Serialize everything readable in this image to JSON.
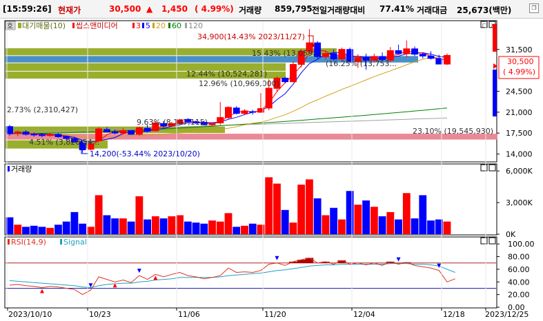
{
  "header": {
    "time": "[15:59:26]",
    "price_label": "현재가",
    "price": "30,500",
    "arrow": "▲",
    "change": "1,450",
    "change_pct": "( 4.99%)",
    "volume_label": "거래량",
    "volume": "859,795",
    "prev_vol_label": "전일거래량대비",
    "prev_vol_ratio": "77.41%",
    "amount_label": "거래대금",
    "amount": "25,673(백만)",
    "restore_icon": "restore-icon"
  },
  "colors": {
    "up": "#ff0000",
    "down": "#0000ff",
    "ma3": "#ff0000",
    "ma5": "#0000ff",
    "ma20": "#d4a017",
    "ma60": "#008000",
    "ma120": "#a0a0a0",
    "band_green": "#9aae2e",
    "band_blue": "#4a90c8",
    "band_pink": "#e98a96",
    "rsi": "#e03020",
    "signal": "#20a0c0",
    "rsi_fill": "#b00000"
  },
  "main_panel": {
    "legend": {
      "market_profile": "대기매물(10)",
      "stock_name": "씹스앤미디어",
      "ma3": "3",
      "ma5": "5",
      "ma20": "20",
      "ma60": "60",
      "ma120": "120"
    },
    "y_ticks": [
      "31,500",
      "24,500",
      "21,000",
      "17,500",
      "14,000"
    ],
    "current_price_box": "30,500",
    "current_pct_box": "( 4.99%)",
    "high_annotation": "34,900(14.43% 2023/11/27)",
    "low_annotation": "14,200(-53.44% 2023/10/20)",
    "volume_bands": [
      {
        "label": "15.43% (13,059...",
        "color": "green"
      },
      {
        "label": "(16.25% (13,753...",
        "color": "blue"
      },
      {
        "label": "12.44% (10,524,281)",
        "color": "green"
      },
      {
        "label": "12.96% (10,969,000)",
        "color": "green"
      },
      {
        "label": "2.73% (2,310,427)",
        "color": "none"
      },
      {
        "label": "9.63% (8,147,115)",
        "color": "green"
      },
      {
        "label": "23.10% (19,545,930)",
        "color": "pink"
      },
      {
        "label": "4.51% (3,820,54...",
        "color": "green"
      }
    ],
    "badge": "호"
  },
  "volume_panel": {
    "legend": "거래량",
    "y_ticks": [
      "6,000K",
      "3,000K",
      "0K"
    ]
  },
  "rsi_panel": {
    "legend_rsi": "RSI(14,9)",
    "legend_signal": "Signal",
    "y_ticks": [
      "100.00",
      "80.00",
      "60.00",
      "40.00",
      "20.00",
      "0.00"
    ]
  },
  "x_axis": {
    "labels": [
      "2023/10/10",
      "10/23",
      "11/06",
      "11/20",
      "12/04",
      "12/18",
      "2023/12/25"
    ]
  },
  "chart_data": {
    "type": "candlestick",
    "candles": [
      {
        "o": 18600,
        "h": 18900,
        "l": 17100,
        "c": 17400
      },
      {
        "o": 17600,
        "h": 18000,
        "l": 17000,
        "c": 17700
      },
      {
        "o": 17700,
        "h": 18000,
        "l": 17100,
        "c": 17300
      },
      {
        "o": 17300,
        "h": 17600,
        "l": 16900,
        "c": 17200
      },
      {
        "o": 17200,
        "h": 17500,
        "l": 16800,
        "c": 17100
      },
      {
        "o": 17100,
        "h": 17500,
        "l": 16900,
        "c": 17300
      },
      {
        "o": 17300,
        "h": 17500,
        "l": 16700,
        "c": 16900
      },
      {
        "o": 16900,
        "h": 17100,
        "l": 16300,
        "c": 16600
      },
      {
        "o": 16600,
        "h": 16900,
        "l": 15900,
        "c": 16000
      },
      {
        "o": 15800,
        "h": 16000,
        "l": 14200,
        "c": 14700
      },
      {
        "o": 14800,
        "h": 16200,
        "l": 14600,
        "c": 15700
      },
      {
        "o": 16200,
        "h": 18500,
        "l": 16000,
        "c": 18200
      },
      {
        "o": 18100,
        "h": 18500,
        "l": 17600,
        "c": 17700
      },
      {
        "o": 17700,
        "h": 18100,
        "l": 17300,
        "c": 17500
      },
      {
        "o": 17500,
        "h": 18300,
        "l": 17300,
        "c": 17900
      },
      {
        "o": 17900,
        "h": 18000,
        "l": 17200,
        "c": 17300
      },
      {
        "o": 17300,
        "h": 18600,
        "l": 17100,
        "c": 18400
      },
      {
        "o": 18300,
        "h": 18900,
        "l": 17600,
        "c": 17800
      },
      {
        "o": 17900,
        "h": 19500,
        "l": 17800,
        "c": 19200
      },
      {
        "o": 19100,
        "h": 19500,
        "l": 18400,
        "c": 18700
      },
      {
        "o": 18700,
        "h": 19400,
        "l": 18500,
        "c": 19100
      },
      {
        "o": 19100,
        "h": 19900,
        "l": 18800,
        "c": 19700
      },
      {
        "o": 19800,
        "h": 20000,
        "l": 19300,
        "c": 19400
      },
      {
        "o": 19400,
        "h": 19600,
        "l": 19000,
        "c": 19200
      },
      {
        "o": 19300,
        "h": 19600,
        "l": 18800,
        "c": 18900
      },
      {
        "o": 18900,
        "h": 19300,
        "l": 18700,
        "c": 19100
      },
      {
        "o": 19200,
        "h": 22700,
        "l": 18900,
        "c": 20100
      },
      {
        "o": 20100,
        "h": 22000,
        "l": 19900,
        "c": 21800
      },
      {
        "o": 21700,
        "h": 22000,
        "l": 20600,
        "c": 20800
      },
      {
        "o": 20800,
        "h": 21500,
        "l": 20500,
        "c": 21200
      },
      {
        "o": 21100,
        "h": 21400,
        "l": 20600,
        "c": 21000
      },
      {
        "o": 21000,
        "h": 24200,
        "l": 20900,
        "c": 21600
      },
      {
        "o": 21700,
        "h": 26500,
        "l": 21300,
        "c": 25000
      },
      {
        "o": 25000,
        "h": 27000,
        "l": 24500,
        "c": 26700
      },
      {
        "o": 26700,
        "h": 26900,
        "l": 25800,
        "c": 26100
      },
      {
        "o": 26100,
        "h": 29500,
        "l": 26000,
        "c": 29000
      },
      {
        "o": 29000,
        "h": 31500,
        "l": 28500,
        "c": 31200
      },
      {
        "o": 31200,
        "h": 34900,
        "l": 30800,
        "c": 32600
      },
      {
        "o": 32600,
        "h": 32900,
        "l": 30000,
        "c": 30300
      },
      {
        "o": 30300,
        "h": 31300,
        "l": 29800,
        "c": 30800
      },
      {
        "o": 30800,
        "h": 31500,
        "l": 29600,
        "c": 29900
      },
      {
        "o": 29900,
        "h": 31800,
        "l": 29700,
        "c": 31500
      },
      {
        "o": 31500,
        "h": 31800,
        "l": 29300,
        "c": 29500
      },
      {
        "o": 29500,
        "h": 30700,
        "l": 28400,
        "c": 30100
      },
      {
        "o": 30200,
        "h": 30800,
        "l": 28100,
        "c": 29700
      },
      {
        "o": 29700,
        "h": 30800,
        "l": 29300,
        "c": 30300
      },
      {
        "o": 30300,
        "h": 31000,
        "l": 29500,
        "c": 29800
      },
      {
        "o": 29700,
        "h": 31900,
        "l": 29400,
        "c": 31300
      },
      {
        "o": 31300,
        "h": 32300,
        "l": 30700,
        "c": 30800
      },
      {
        "o": 30800,
        "h": 33000,
        "l": 30200,
        "c": 31600
      },
      {
        "o": 31600,
        "h": 32000,
        "l": 30400,
        "c": 30700
      },
      {
        "o": 30700,
        "h": 31000,
        "l": 30000,
        "c": 30400
      },
      {
        "o": 30400,
        "h": 31200,
        "l": 29800,
        "c": 30000
      },
      {
        "o": 30000,
        "h": 30600,
        "l": 29000,
        "c": 29050
      },
      {
        "o": 29050,
        "h": 30800,
        "l": 28900,
        "c": 30500
      }
    ],
    "volumes_k": [
      1600,
      900,
      700,
      800,
      700,
      600,
      900,
      1200,
      2100,
      1000,
      700,
      3700,
      1800,
      1500,
      1500,
      1200,
      3600,
      1400,
      1700,
      1500,
      1700,
      1800,
      1200,
      1100,
      1000,
      1300,
      1200,
      2000,
      700,
      800,
      1000,
      900,
      5400,
      4800,
      2300,
      1100,
      4700,
      5200,
      3400,
      1800,
      2500,
      1400,
      4100,
      2800,
      3200,
      2600,
      1700,
      2100,
      1400,
      3900,
      1500,
      3700,
      1300,
      1400,
      1200,
      800
    ],
    "rsi": [
      35,
      36,
      34,
      33,
      31,
      33,
      32,
      30,
      28,
      20,
      27,
      48,
      44,
      40,
      43,
      39,
      50,
      44,
      52,
      48,
      52,
      55,
      50,
      48,
      45,
      47,
      50,
      62,
      55,
      56,
      55,
      58,
      68,
      70,
      66,
      72,
      75,
      78,
      70,
      72,
      68,
      74,
      68,
      70,
      67,
      70,
      66,
      72,
      68,
      71,
      66,
      64,
      62,
      58,
      40,
      45
    ],
    "signal": [
      42,
      41,
      40,
      39,
      38,
      37,
      36,
      35,
      34,
      32,
      31,
      34,
      36,
      37,
      38,
      38,
      40,
      41,
      43,
      44,
      45,
      47,
      47,
      47,
      47,
      47,
      48,
      50,
      51,
      52,
      53,
      54,
      56,
      58,
      59,
      61,
      63,
      65,
      66,
      67,
      67,
      68,
      68,
      68,
      68,
      68,
      68,
      69,
      69,
      69,
      68,
      68,
      67,
      65,
      60,
      55
    ],
    "price_ylim": [
      12800,
      36200
    ],
    "volume_ylim": [
      0,
      6600
    ],
    "rsi_ylim": [
      0,
      110
    ]
  }
}
